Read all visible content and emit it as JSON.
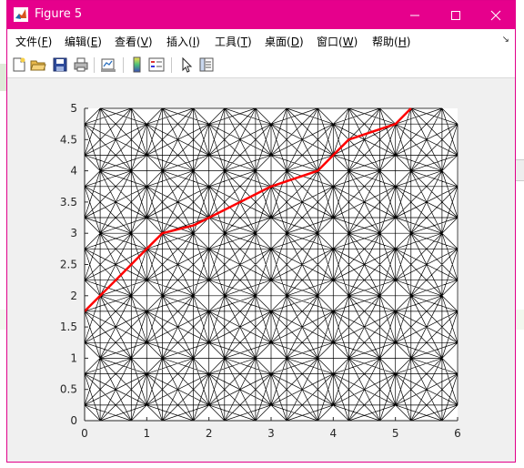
{
  "window": {
    "title": "Figure 5",
    "title_color": "#e6008c"
  },
  "menu": {
    "items": [
      {
        "label": "文件(",
        "key": "F",
        "end": ")"
      },
      {
        "label": "编辑(",
        "key": "E",
        "end": ")"
      },
      {
        "label": "查看(",
        "key": "V",
        "end": ")"
      },
      {
        "label": "插入(",
        "key": "I",
        "end": ")"
      },
      {
        "label": "工具(",
        "key": "T",
        "end": ")"
      },
      {
        "label": "桌面(",
        "key": "D",
        "end": ")"
      },
      {
        "label": "窗口(",
        "key": "W",
        "end": ")"
      },
      {
        "label": "帮助(",
        "key": "H",
        "end": ")"
      }
    ]
  },
  "toolbar": {
    "icons": [
      "new-figure-icon",
      "open-file-icon",
      "save-icon",
      "print-icon",
      "link-plot-icon",
      "colorbar-icon",
      "legend-icon",
      "edit-pointer-icon",
      "property-inspector-icon"
    ]
  },
  "chart_data": {
    "type": "line",
    "title": "",
    "xlabel": "",
    "ylabel": "",
    "xlim": [
      0,
      6
    ],
    "ylim": [
      0,
      5
    ],
    "xticks": [
      0,
      1,
      2,
      3,
      4,
      5,
      6
    ],
    "yticks": [
      0,
      0.5,
      1,
      1.5,
      2,
      2.5,
      3,
      3.5,
      4,
      4.5,
      5
    ],
    "grid": false,
    "network": {
      "description_free": true,
      "node_x": [
        0,
        0.25,
        0.75,
        1,
        1.25,
        1.75,
        2,
        2.25,
        2.75,
        3,
        3.25,
        3.75,
        4,
        4.25,
        4.75,
        5,
        5.25,
        5.75,
        6
      ],
      "node_y": [
        0,
        0.25,
        0.75,
        1,
        1.25,
        1.75,
        2,
        2.25,
        2.75,
        3,
        3.25,
        3.75,
        4,
        4.25,
        4.75,
        5
      ],
      "color": "#000000"
    },
    "series": [
      {
        "color": "#ff0000",
        "x": [
          0,
          0.25,
          0.5,
          0.75,
          1.0,
          1.25,
          1.75,
          2.25,
          3.0,
          3.75,
          4.0,
          4.25,
          5.0,
          5.25
        ],
        "y": [
          1.75,
          2.0,
          2.25,
          2.5,
          2.75,
          3.0,
          3.125,
          3.375,
          3.75,
          4.0,
          4.25,
          4.5,
          4.75,
          5.0
        ]
      }
    ]
  }
}
